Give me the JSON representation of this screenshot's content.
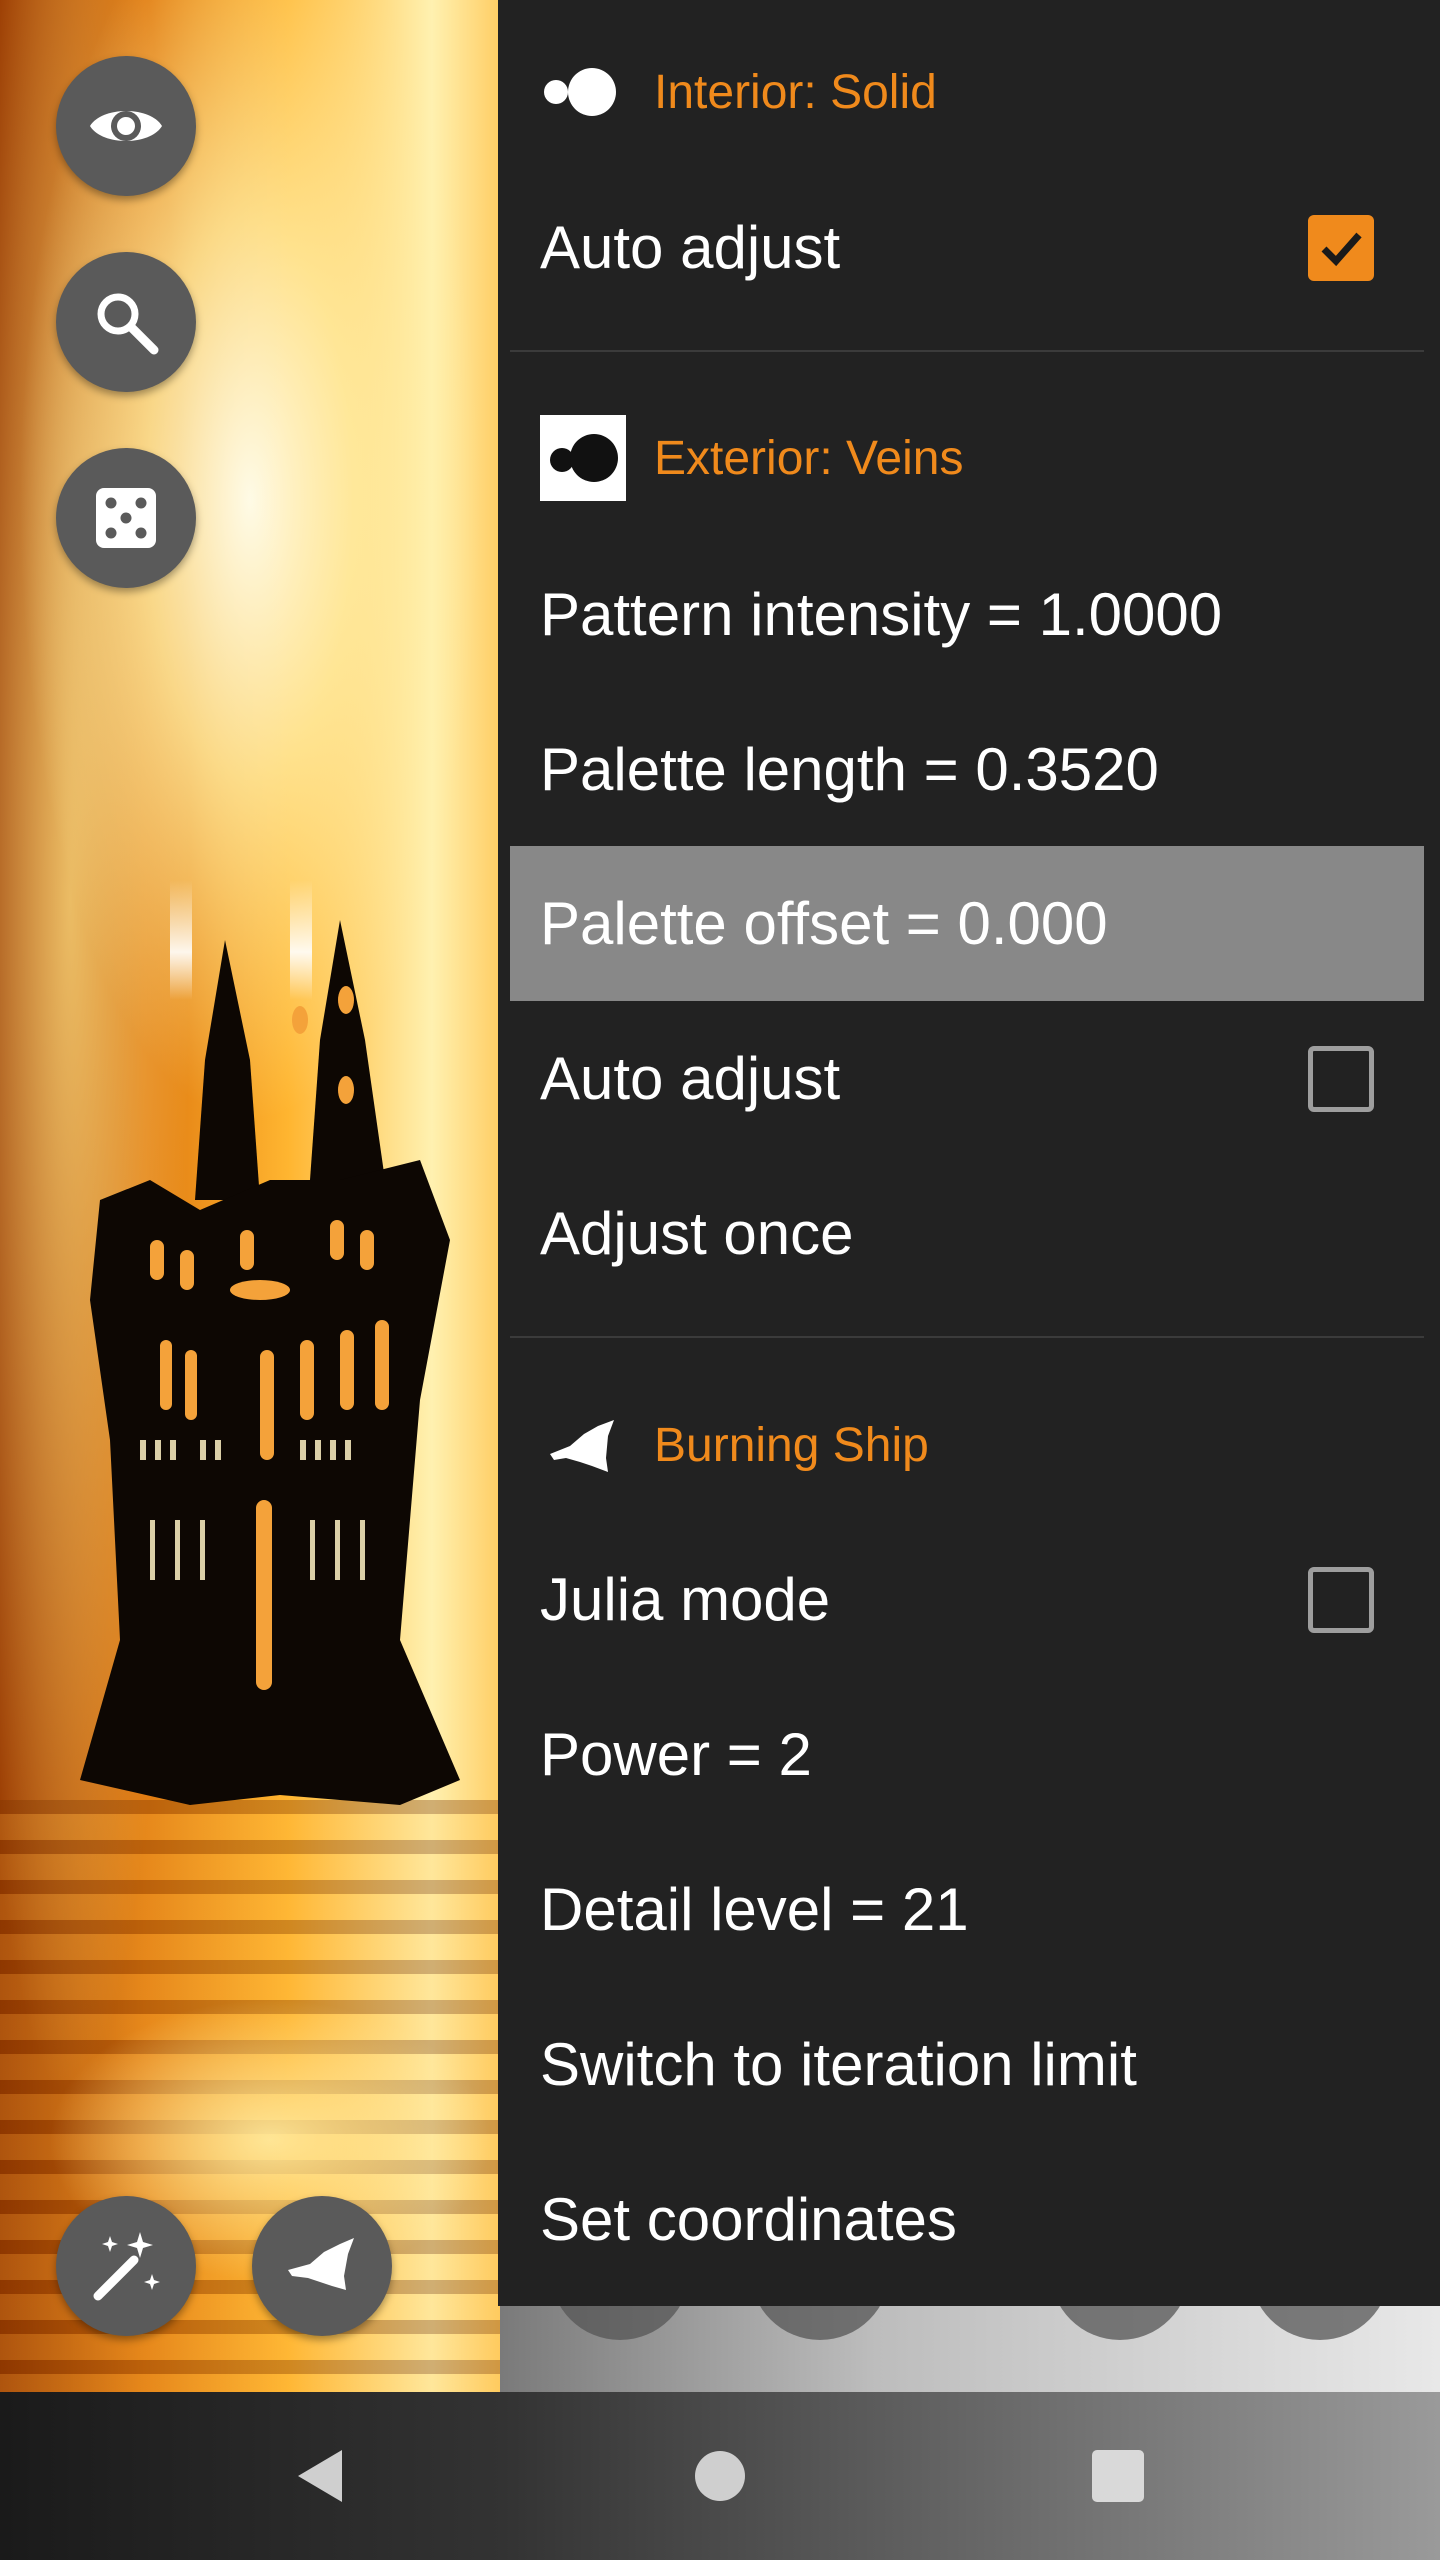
{
  "colors": {
    "accent": "#f08a1c",
    "panel_bg": "#222222",
    "highlight_row": "#888888",
    "fab_bg": "#5a5a5a"
  },
  "side_buttons": {
    "top": [
      {
        "name": "visibility-button",
        "icon": "eye-icon"
      },
      {
        "name": "zoom-button",
        "icon": "magnifier-icon"
      },
      {
        "name": "randomize-button",
        "icon": "dice-icon"
      }
    ],
    "bottom": [
      {
        "name": "magic-wand-button",
        "icon": "magic-wand-icon"
      },
      {
        "name": "fractal-type-button",
        "icon": "burning-ship-icon"
      }
    ]
  },
  "settings": {
    "interior": {
      "title": "Interior: Solid",
      "icon": "interior-solid-icon",
      "auto_adjust": {
        "label": "Auto adjust",
        "checked": true
      }
    },
    "exterior": {
      "title": "Exterior: Veins",
      "icon": "exterior-veins-icon",
      "pattern_intensity": "Pattern intensity = 1.0000",
      "palette_length": "Palette length = 0.3520",
      "palette_offset": "Palette offset = 0.000",
      "auto_adjust": {
        "label": "Auto adjust",
        "checked": false
      },
      "adjust_once": "Adjust once"
    },
    "fractal": {
      "title": "Burning Ship",
      "icon": "burning-ship-icon",
      "julia_mode": {
        "label": "Julia mode",
        "checked": false
      },
      "power": "Power = 2",
      "detail_level": "Detail level = 21",
      "switch_limit": "Switch to iteration limit",
      "set_coordinates": "Set coordinates"
    }
  },
  "navbar": {
    "back": "back-triangle-icon",
    "home": "home-circle-icon",
    "recents": "recents-square-icon"
  }
}
